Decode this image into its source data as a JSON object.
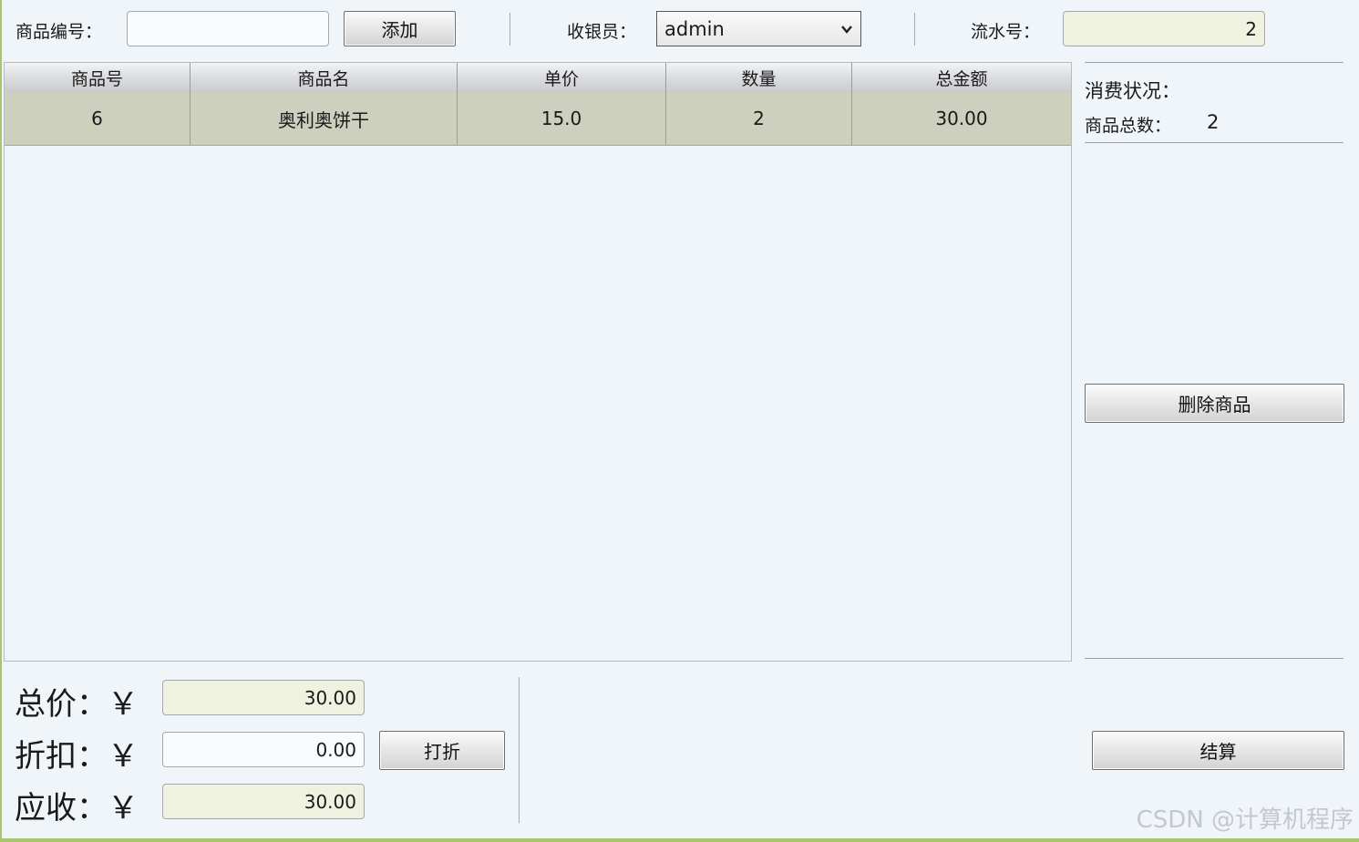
{
  "toolbar": {
    "product_no_label": "商品编号：",
    "product_no_value": "",
    "add_button": "添加",
    "cashier_label": "收银员：",
    "cashier_value": "admin",
    "serial_label": "流水号：",
    "serial_value": "2"
  },
  "table": {
    "columns": [
      "商品号",
      "商品名",
      "单价",
      "数量",
      "总金额"
    ],
    "rows": [
      [
        "6",
        "奥利奥饼干",
        "15.0",
        "2",
        "30.00"
      ]
    ]
  },
  "side": {
    "status_label": "消费状况：",
    "total_count_label": "商品总数：",
    "total_count_value": "2",
    "delete_button": "删除商品",
    "checkout_button": "结算"
  },
  "summary": {
    "total_label": "总价：￥",
    "total_value": "30.00",
    "discount_label": "折扣：￥",
    "discount_value": "0.00",
    "discount_button": "打折",
    "receivable_label": "应收：￥",
    "receivable_value": "30.00"
  },
  "watermark": "CSDN @计算机程序"
}
